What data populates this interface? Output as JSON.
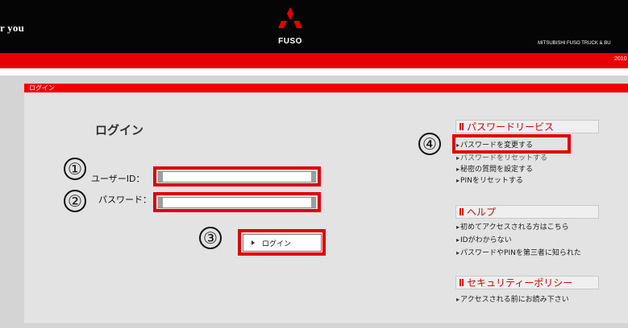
{
  "header": {
    "tagline": "r you",
    "brand": "FUSO",
    "company": "MITSUBISHI FUSO TRUCK & BU",
    "redbar_text": "2010"
  },
  "panel": {
    "title": "ログイン"
  },
  "login": {
    "heading": "ログイン",
    "user_id_label": "ユーザーID：",
    "password_label": "パスワード：",
    "user_id_value": "",
    "password_value": "",
    "button_label": "ログイン"
  },
  "annotations": {
    "n1": "①",
    "n2": "②",
    "n3": "③",
    "n4": "④"
  },
  "sidebar": {
    "sections": [
      {
        "title": "パスワードリービス",
        "links": [
          "パスワードを変更する",
          "パスワードをリセットする",
          "秘密の質問を設定する",
          "PINをリセットする"
        ]
      },
      {
        "title": "ヘルプ",
        "links": [
          "初めてアクセスされる方はこちら",
          "IDがわからない",
          "パスワードやPINを第三者に知られた"
        ]
      },
      {
        "title": "セキュリティーポリシー",
        "links": [
          "アクセスされる前にお読み下さい"
        ]
      }
    ]
  },
  "colors": {
    "accent_red": "#e60000",
    "header_black": "#050505",
    "highlight_red": "#e00000"
  },
  "icons": {
    "logo": "three-diamonds-logo",
    "bullet": "triangle-right-icon",
    "section_marker": "bars-icon"
  }
}
